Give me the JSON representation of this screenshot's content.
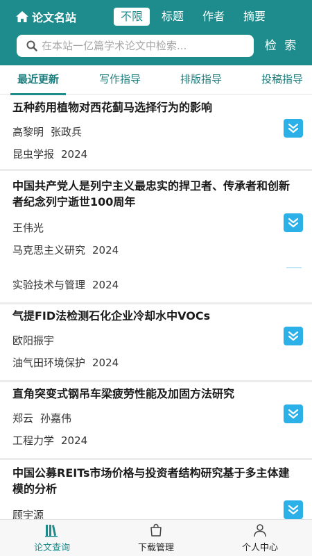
{
  "header": {
    "brand": "论文名站",
    "filters": [
      "不限",
      "标题",
      "作者",
      "摘要"
    ],
    "active_filter": "不限",
    "search_placeholder": "在本站一亿篇学术论文中检索...",
    "search_button": "检 索"
  },
  "tabs": [
    "最近更新",
    "写作指导",
    "排版指导",
    "投稿指导"
  ],
  "active_tab": "最近更新",
  "items": [
    {
      "title": "五种药用植物对西花蓟马选择行为的影响",
      "authors": [
        "高黎明",
        "张政兵"
      ],
      "journal": "昆虫学报",
      "year": "2024"
    },
    {
      "title": "中国共产党人是列宁主义最忠实的捍卫者、传承者和创新者纪念列宁逝世100周年",
      "authors": [
        "王伟光"
      ],
      "journal": "马克思主义研究",
      "year": "2024"
    },
    {
      "title": "",
      "authors": [],
      "journal": "实验技术与管理",
      "year": "2024"
    },
    {
      "title": "气提FID法检测石化企业冷却水中VOCs",
      "authors": [
        "欧阳振宇"
      ],
      "journal": "油气田环境保护",
      "year": "2024"
    },
    {
      "title": "直角突变式钢吊车梁疲劳性能及加固方法研究",
      "authors": [
        "郑云",
        "孙嘉伟"
      ],
      "journal": "工程力学",
      "year": "2024"
    },
    {
      "title": "中国公募REITs市场价格与投资者结构研究基于多主体建模的分析",
      "authors": [
        "顾宇源"
      ],
      "journal": "",
      "year": ""
    }
  ],
  "bottom_nav": [
    "论文查询",
    "下载管理",
    "个人中心"
  ],
  "active_nav": "论文查询",
  "colors": {
    "primary": "#1e8c8c",
    "expand_button": "#2bb0e8"
  },
  "icons": [
    "home-icon",
    "search-icon",
    "chevron-double-down-icon",
    "books-icon",
    "shopping-bag-icon",
    "person-icon"
  ]
}
